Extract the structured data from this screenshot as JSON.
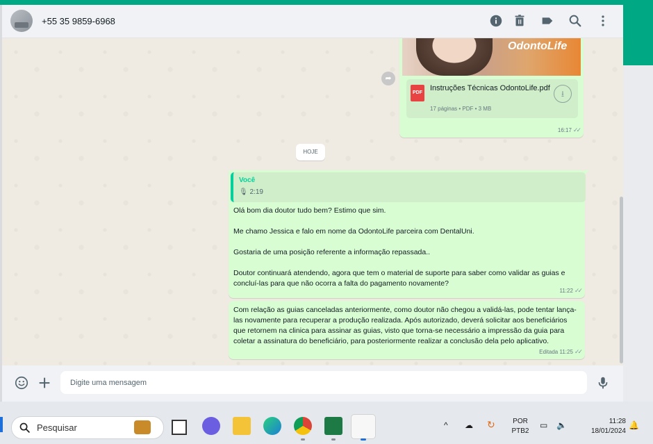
{
  "header": {
    "contact": "+55 35 9859-6968",
    "icons": [
      "info-icon",
      "trash-icon",
      "label-icon",
      "search-icon",
      "more-vertical-icon"
    ]
  },
  "messages": {
    "doc": {
      "logo": "OdontoLife",
      "filename": "Instruções Técnicas OdontoLife.pdf",
      "badge": "PDF",
      "meta": "17 páginas • PDF • 3 MB",
      "time": "16:17"
    },
    "date_chip": "HOJE",
    "reply": {
      "author": "Você",
      "audio": "2:19",
      "p1": "Olá bom dia doutor tudo bem? Estimo que sim.",
      "p2": "Me chamo Jessica e falo em nome da OdontoLife parceira com DentalUni.",
      "p3": "Gostaria de uma posição referente a informação repassada..",
      "p4": "Doutor continuará atendendo, agora que tem o material de suporte para saber como validar as guias e concluí-las para que não ocorra a falta do pagamento novamente?",
      "time": "11:22"
    },
    "followup": {
      "text": "Com relação as guias canceladas anteriormente, como doutor não chegou a validá-las,  pode tentar lança-las novamente para recuperar a produção realizada. Após autorizado, deverá solicitar aos beneficiários que retornem na clinica para assinar as guias, visto que torna-se necessário a impressão da guia para coletar a assinatura do beneficiário, para posteriormente realizar a conclusão dela pelo aplicativo.",
      "time": "Editada 11:25"
    }
  },
  "composer": {
    "placeholder": "Digite uma mensagem"
  },
  "taskbar": {
    "search_label": "Pesquisar",
    "lang_line1": "POR",
    "lang_line2": "PTB2",
    "clock_time": "11:28",
    "clock_date": "18/01/2024"
  },
  "colors": {
    "accent": "#00a884",
    "bubble_out": "#d9fdd3",
    "chat_bg": "#efeae2"
  }
}
